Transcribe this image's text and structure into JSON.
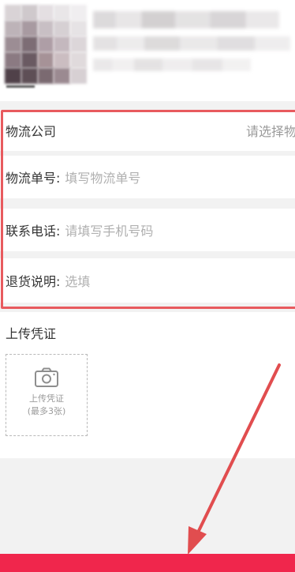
{
  "form": {
    "company_label": "物流公司",
    "company_select_placeholder": "请选择物",
    "tracking_label": "物流单号:",
    "tracking_placeholder": "填写物流单号",
    "phone_label": "联系电话:",
    "phone_placeholder": "请填写手机号码",
    "notes_label": "退货说明:",
    "notes_placeholder": "选填"
  },
  "upload": {
    "title": "上传凭证",
    "box_label": "上传凭证",
    "box_limit": "(最多3张)",
    "icon": "camera-icon"
  },
  "colors": {
    "highlight": "#e85a5e",
    "submit_bar": "#f0264c",
    "arrow": "#e14d4f"
  }
}
